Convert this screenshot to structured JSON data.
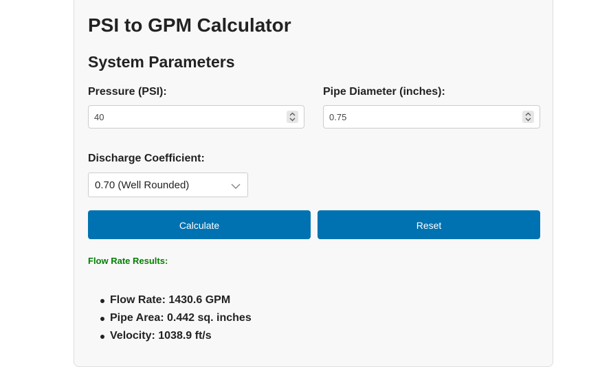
{
  "page": {
    "title": "PSI to GPM Calculator"
  },
  "parameters": {
    "section_title": "System Parameters",
    "pressure": {
      "label": "Pressure (PSI):",
      "value": "40"
    },
    "pipe_diameter": {
      "label": "Pipe Diameter (inches):",
      "value": "0.75"
    },
    "discharge_coefficient": {
      "label": "Discharge Coefficient:",
      "selected": "0.70 (Well Rounded)"
    }
  },
  "buttons": {
    "calculate_label": "Calculate",
    "reset_label": "Reset"
  },
  "results": {
    "title": "Flow Rate Results:",
    "items": [
      "Flow Rate: 1430.6 GPM",
      "Pipe Area: 0.442 sq. inches",
      "Velocity: 1038.9 ft/s"
    ]
  },
  "colors": {
    "button_bg": "#0072b1",
    "results_title": "#008000",
    "card_bg": "#f8f8f8"
  },
  "icons": {
    "spinner": "spinner-updown-icon",
    "dropdown": "chevron-down-icon"
  }
}
